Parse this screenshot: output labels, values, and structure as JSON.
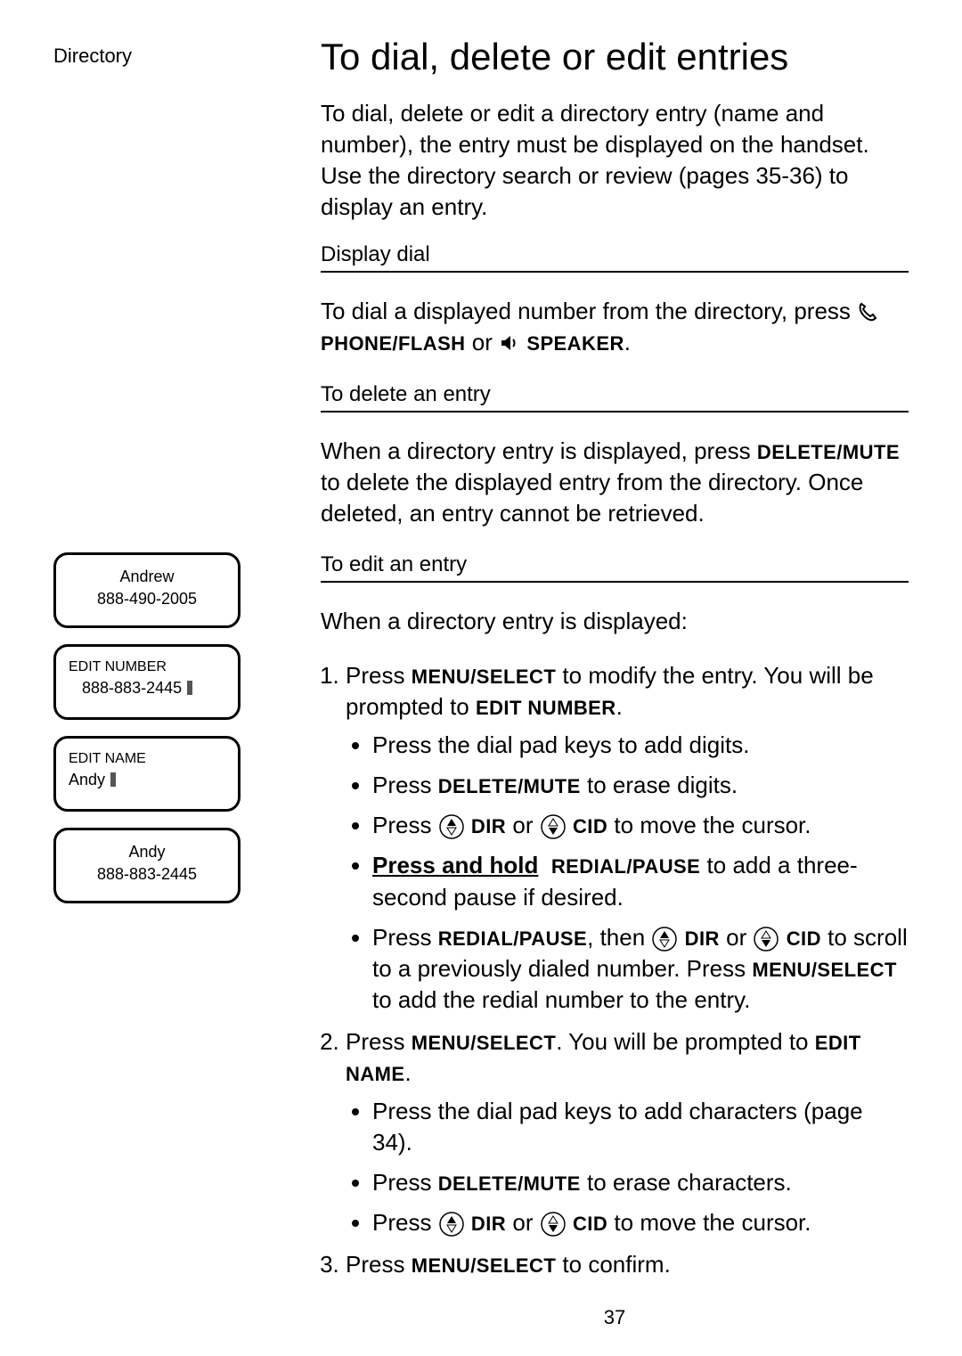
{
  "sidebar_label": "Directory",
  "title": "To dial, delete or edit entries",
  "intro": "To dial, delete or edit a directory entry (name and number), the entry must be displayed on the handset. Use the directory search or review (pages 35-36) to display an entry.",
  "sections": {
    "display_dial": {
      "heading": "Display dial",
      "line_pre": "To dial a displayed number from the directory, press ",
      "phone_flash": "PHONE/FLASH",
      "or": " or ",
      "speaker": "SPEAKER",
      "period": "."
    },
    "delete": {
      "heading": "To delete an entry",
      "line_pre": "When a directory entry is displayed, press ",
      "delete_mute": "DELETE/MUTE",
      "line_post": " to delete the displayed entry from the directory. Once deleted, an entry cannot be retrieved."
    },
    "edit": {
      "heading": "To edit an entry",
      "lead": "When a directory entry is displayed:",
      "step1_pre": "Press ",
      "menu_select": "MENU/SELECT",
      "step1_mid": " to modify the entry. You will be prompted to ",
      "edit_number": "EDIT NUMBER",
      "period": ".",
      "b1": "Press the dial pad keys to add digits.",
      "b2_pre": "Press ",
      "delete_mute2": "DELETE/MUTE",
      "b2_post": " to erase digits.",
      "b3_pre": "Press ",
      "dir": "DIR",
      "b3_or": " or ",
      "cid": "CID",
      "b3_post": " to move the cursor.",
      "b4_hold": "Press and hold",
      "redial_pause": "REDIAL/PAUSE",
      "b4_post": " to add a three-second pause if desired.",
      "b5_pre": "Press ",
      "b5_then": ", then ",
      "b5_mid": " to scroll to a previously dialed number. Press ",
      "b5_post": " to add the redial number to the entry.",
      "step2_pre": "Press ",
      "step2_mid": ". You will be prompted to ",
      "edit_name": "EDIT NAME",
      "b6": "Press the dial pad keys to add characters (page 34).",
      "b7_pre": "Press ",
      "b7_post": " to erase characters.",
      "b8_pre": "Press ",
      "b8_post": " to move the cursor.",
      "step3_pre": "Press ",
      "step3_post": " to confirm."
    }
  },
  "screens": {
    "s1": {
      "name": "Andrew",
      "number": "888-490-2005"
    },
    "s2": {
      "label": "EDIT NUMBER",
      "value": "888-883-2445"
    },
    "s3": {
      "label": "EDIT NAME",
      "value": "Andy"
    },
    "s4": {
      "name": "Andy",
      "number": "888-883-2445"
    }
  },
  "page_number": "37"
}
